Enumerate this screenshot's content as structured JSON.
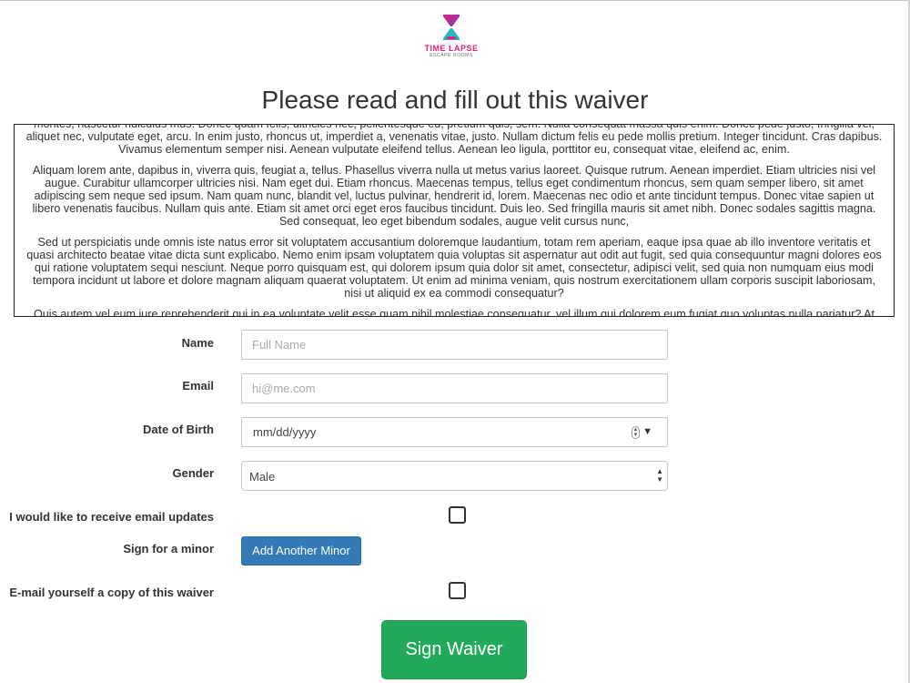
{
  "logo": {
    "title": "TIME LAPSE",
    "subtitle": "ESCAPE ROOMS",
    "icon": "hourglass-icon",
    "colors": {
      "pink": "#e0207a",
      "teal": "#2ab6c9"
    }
  },
  "page_title": "Please read and fill out this waiver",
  "waiver": {
    "paragraphs": [
      "montes, nascetur ridiculus mus. Donec quam felis, ultricies nec, pellentesque eu, pretium quis, sem. Nulla consequat massa quis enim. Donec pede justo, fringilla vel, aliquet nec, vulputate eget, arcu. In enim justo, rhoncus ut, imperdiet a, venenatis vitae, justo. Nullam dictum felis eu pede mollis pretium. Integer tincidunt. Cras dapibus. Vivamus elementum semper nisi. Aenean vulputate eleifend tellus. Aenean leo ligula, porttitor eu, consequat vitae, eleifend ac, enim.",
      "Aliquam lorem ante, dapibus in, viverra quis, feugiat a, tellus. Phasellus viverra nulla ut metus varius laoreet. Quisque rutrum. Aenean imperdiet. Etiam ultricies nisi vel augue. Curabitur ullamcorper ultricies nisi. Nam eget dui. Etiam rhoncus. Maecenas tempus, tellus eget condimentum rhoncus, sem quam semper libero, sit amet adipiscing sem neque sed ipsum. Nam quam nunc, blandit vel, luctus pulvinar, hendrerit id, lorem. Maecenas nec odio et ante tincidunt tempus. Donec vitae sapien ut libero venenatis faucibus. Nullam quis ante. Etiam sit amet orci eget eros faucibus tincidunt. Duis leo. Sed fringilla mauris sit amet nibh. Donec sodales sagittis magna. Sed consequat, leo eget bibendum sodales, augue velit cursus nunc,",
      "Sed ut perspiciatis unde omnis iste natus error sit voluptatem accusantium doloremque laudantium, totam rem aperiam, eaque ipsa quae ab illo inventore veritatis et quasi architecto beatae vitae dicta sunt explicabo. Nemo enim ipsam voluptatem quia voluptas sit aspernatur aut odit aut fugit, sed quia consequuntur magni dolores eos qui ratione voluptatem sequi nesciunt. Neque porro quisquam est, qui dolorem ipsum quia dolor sit amet, consectetur, adipisci velit, sed quia non numquam eius modi tempora incidunt ut labore et dolore magnam aliquam quaerat voluptatem. Ut enim ad minima veniam, quis nostrum exercitationem ullam corporis suscipit laboriosam, nisi ut aliquid ex ea commodi consequatur?",
      "Quis autem vel eum iure reprehenderit qui in ea voluptate velit esse quam nihil molestiae consequatur, vel illum qui dolorem eum fugiat quo voluptas nulla pariatur? At"
    ]
  },
  "form": {
    "name": {
      "label": "Name",
      "placeholder": "Full Name",
      "value": ""
    },
    "email": {
      "label": "Email",
      "placeholder": "hi@me.com",
      "value": ""
    },
    "dob": {
      "label": "Date of Birth",
      "placeholder": "mm/dd/yyyy"
    },
    "gender": {
      "label": "Gender",
      "value": "Male"
    },
    "email_updates": {
      "label": "I would like to receive email updates",
      "checked": false
    },
    "minor": {
      "label": "Sign for a minor",
      "button": "Add Another Minor"
    },
    "email_copy": {
      "label": "E-mail yourself a copy of this waiver",
      "checked": false
    }
  },
  "submit": {
    "label": "Sign Waiver",
    "color": "#22a95a"
  }
}
